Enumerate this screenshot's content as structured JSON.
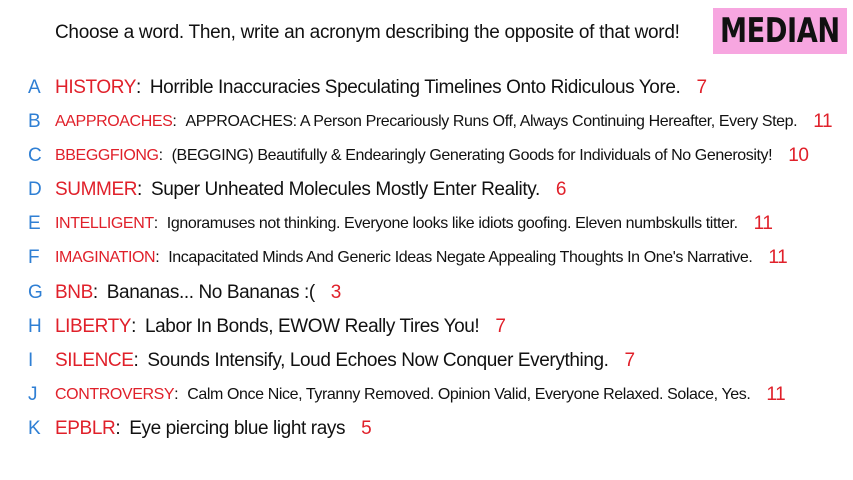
{
  "prompt": "Choose a word. Then, write an acronym describing the opposite of that word!",
  "badge": "MEDIAN",
  "colors": {
    "letter": "#2f7fd4",
    "word": "#e0202a",
    "badge_bg": "#f7a6e0"
  },
  "rows": [
    {
      "letter": "A",
      "word": "HISTORY",
      "acronym": "Horrible Inaccuracies Speculating Timelines Onto Ridiculous Yore.",
      "score": "7"
    },
    {
      "letter": "B",
      "word": "AAPPROACHES",
      "acronym": "APPROACHES: A Person Precariously Runs Off, Always Continuing Hereafter, Every Step.",
      "score": "11"
    },
    {
      "letter": "C",
      "word": "BBEGGFIONG",
      "acronym": "(BEGGING) Beautifully & Endearingly Generating Goods for Individuals of No Generosity!",
      "score": "10"
    },
    {
      "letter": "D",
      "word": "SUMMER",
      "acronym": "Super Unheated Molecules Mostly Enter Reality.",
      "score": "6"
    },
    {
      "letter": "E",
      "word": "INTELLIGENT",
      "acronym": "Ignoramuses not thinking. Everyone looks like idiots goofing. Eleven numbskulls titter.",
      "score": "11"
    },
    {
      "letter": "F",
      "word": "IMAGINATION",
      "acronym": "Incapacitated Minds And Generic Ideas Negate Appealing Thoughts In One's Narrative.",
      "score": "11"
    },
    {
      "letter": "G",
      "word": "BNB",
      "acronym": "Bananas... No Bananas :(",
      "score": "3"
    },
    {
      "letter": "H",
      "word": "LIBERTY",
      "acronym": "Labor In Bonds, EWOW Really Tires You!",
      "score": "7"
    },
    {
      "letter": "I",
      "word": "SILENCE",
      "acronym": "Sounds Intensify, Loud Echoes Now Conquer Everything.",
      "score": "7"
    },
    {
      "letter": "J",
      "word": "CONTROVERSY",
      "acronym": "Calm Once Nice, Tyranny Removed. Opinion Valid, Everyone Relaxed. Solace, Yes.",
      "score": "11"
    },
    {
      "letter": "K",
      "word": "EPBLR",
      "acronym": "Eye piercing blue light rays",
      "score": "5"
    }
  ]
}
